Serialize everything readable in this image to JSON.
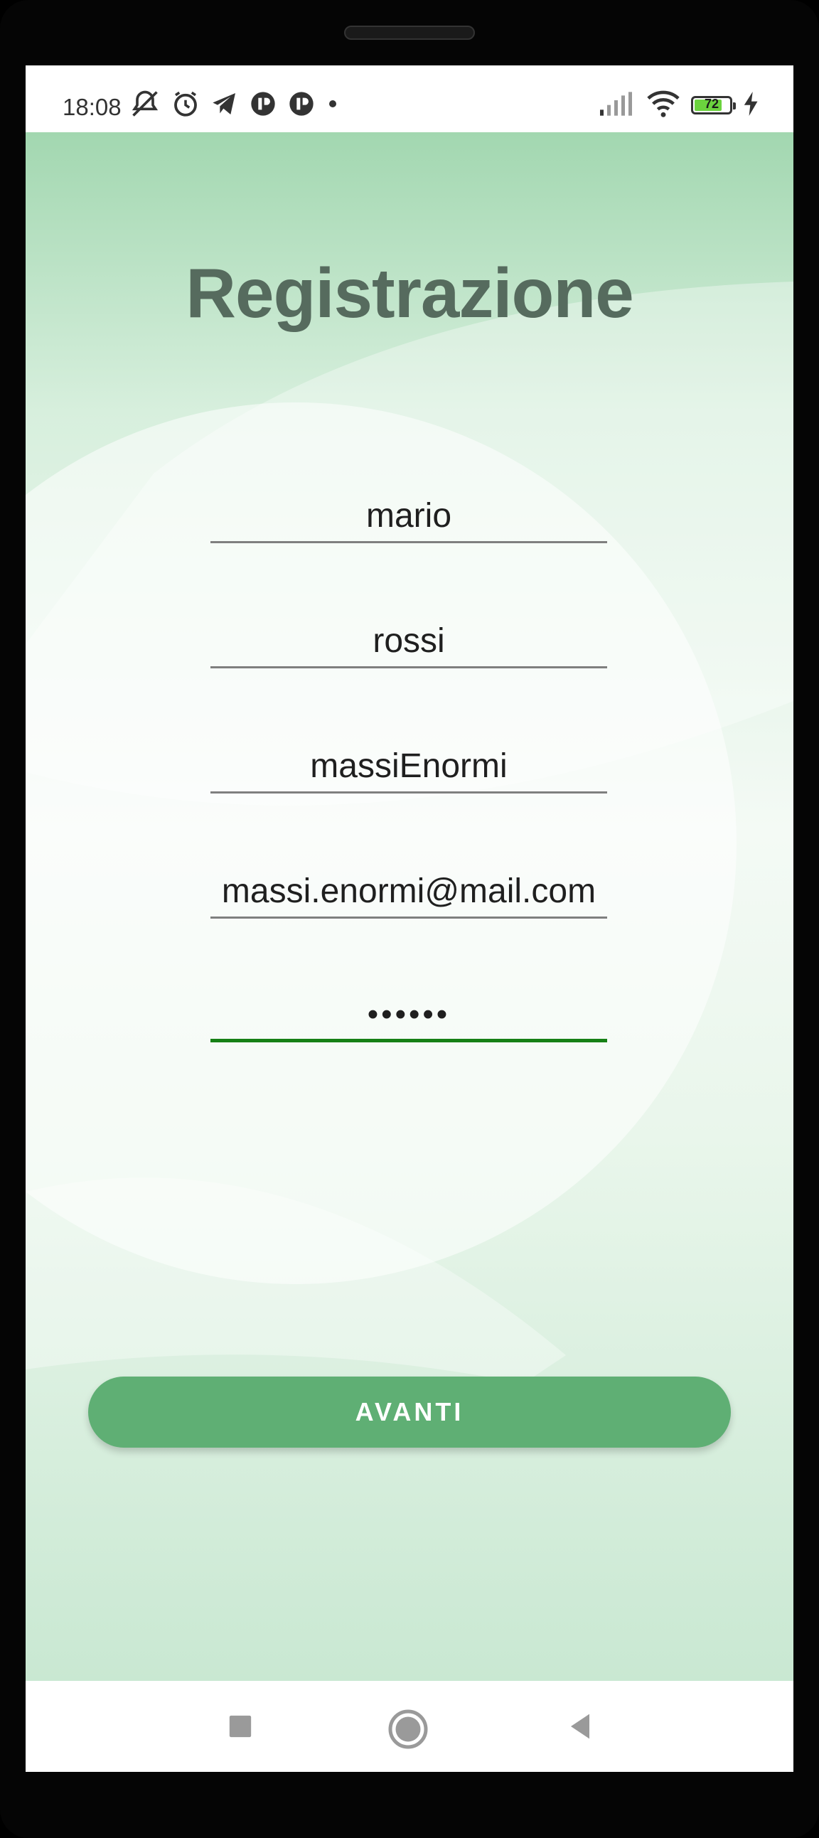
{
  "status_bar": {
    "time": "18:08",
    "battery_level": "72",
    "battery_fraction": 0.72,
    "icons": [
      "muted-notifications-icon",
      "alarm-icon",
      "telegram-icon",
      "app-badge-icon",
      "app-badge-icon",
      "dot-icon",
      "signal-icon",
      "wifi-icon",
      "battery-icon",
      "charging-icon"
    ]
  },
  "page": {
    "title": "Registrazione"
  },
  "form": {
    "first_name": "mario",
    "last_name": "rossi",
    "username": "massiEnormi",
    "email": "massi.enormi@mail.com",
    "password_masked": "••••••"
  },
  "actions": {
    "next_label": "AVANTI"
  },
  "colors": {
    "accent": "#5faf74",
    "title": "#566b5e",
    "active_underline": "#168016"
  },
  "nav": {
    "icons": [
      "recents-square-icon",
      "home-circle-icon",
      "back-triangle-icon"
    ]
  }
}
